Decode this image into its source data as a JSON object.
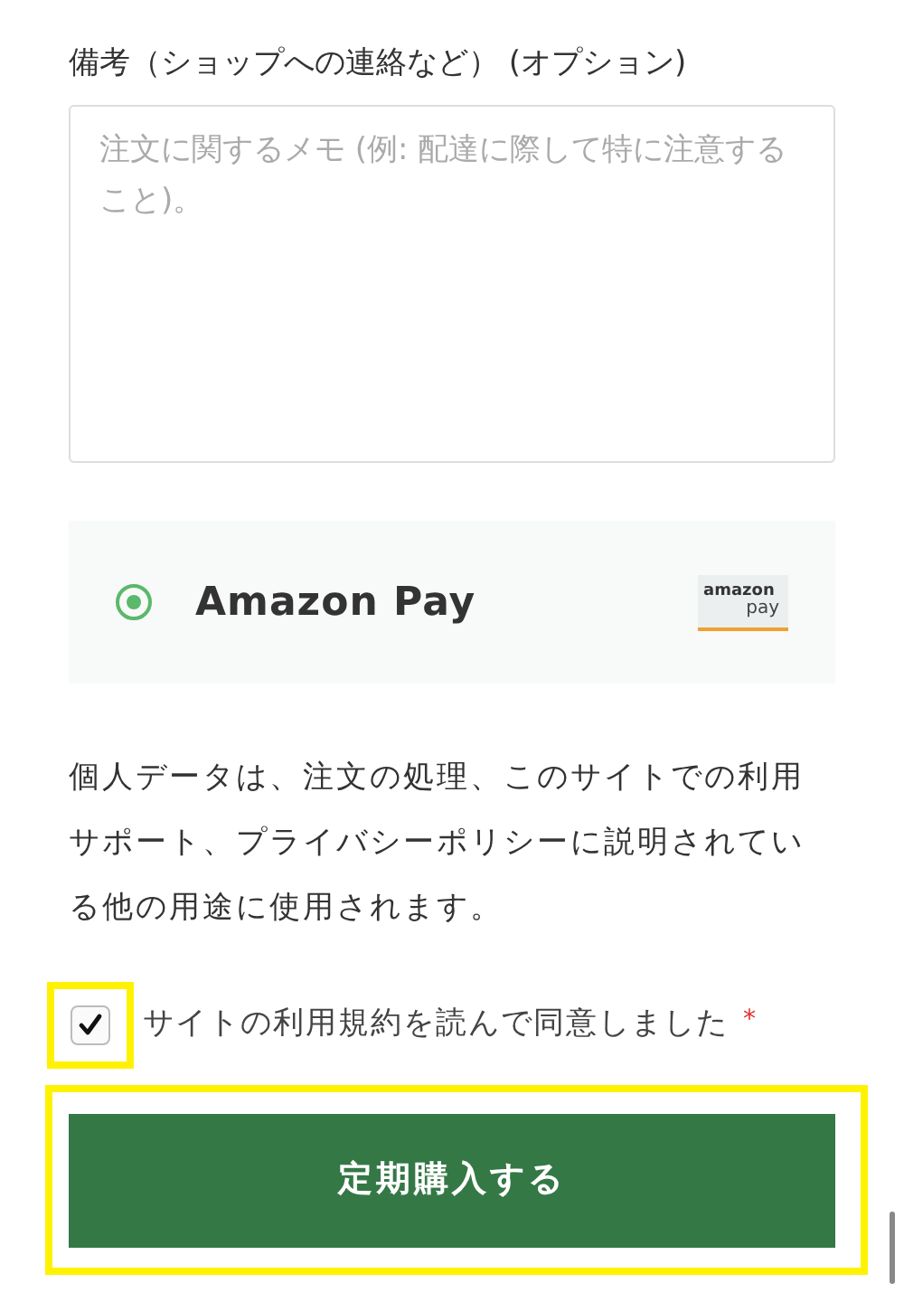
{
  "notes": {
    "label": "備考（ショップへの連絡など） (オプション)",
    "placeholder": "注文に関するメモ (例: 配達に際して特に注意すること)。"
  },
  "payment": {
    "label": "Amazon Pay",
    "selected": true,
    "logo_text": [
      "amazon",
      "pay"
    ]
  },
  "privacy_text": "個人データは、注文の処理、このサイトでの利用サポート、プライバシーポリシーに説明されている他の用途に使用されます。",
  "terms": {
    "label": "サイトの利用規約を読んで同意しました",
    "required_mark": "*",
    "checked": true,
    "highlighted": true
  },
  "submit": {
    "label": "定期購入する",
    "highlighted": true
  }
}
